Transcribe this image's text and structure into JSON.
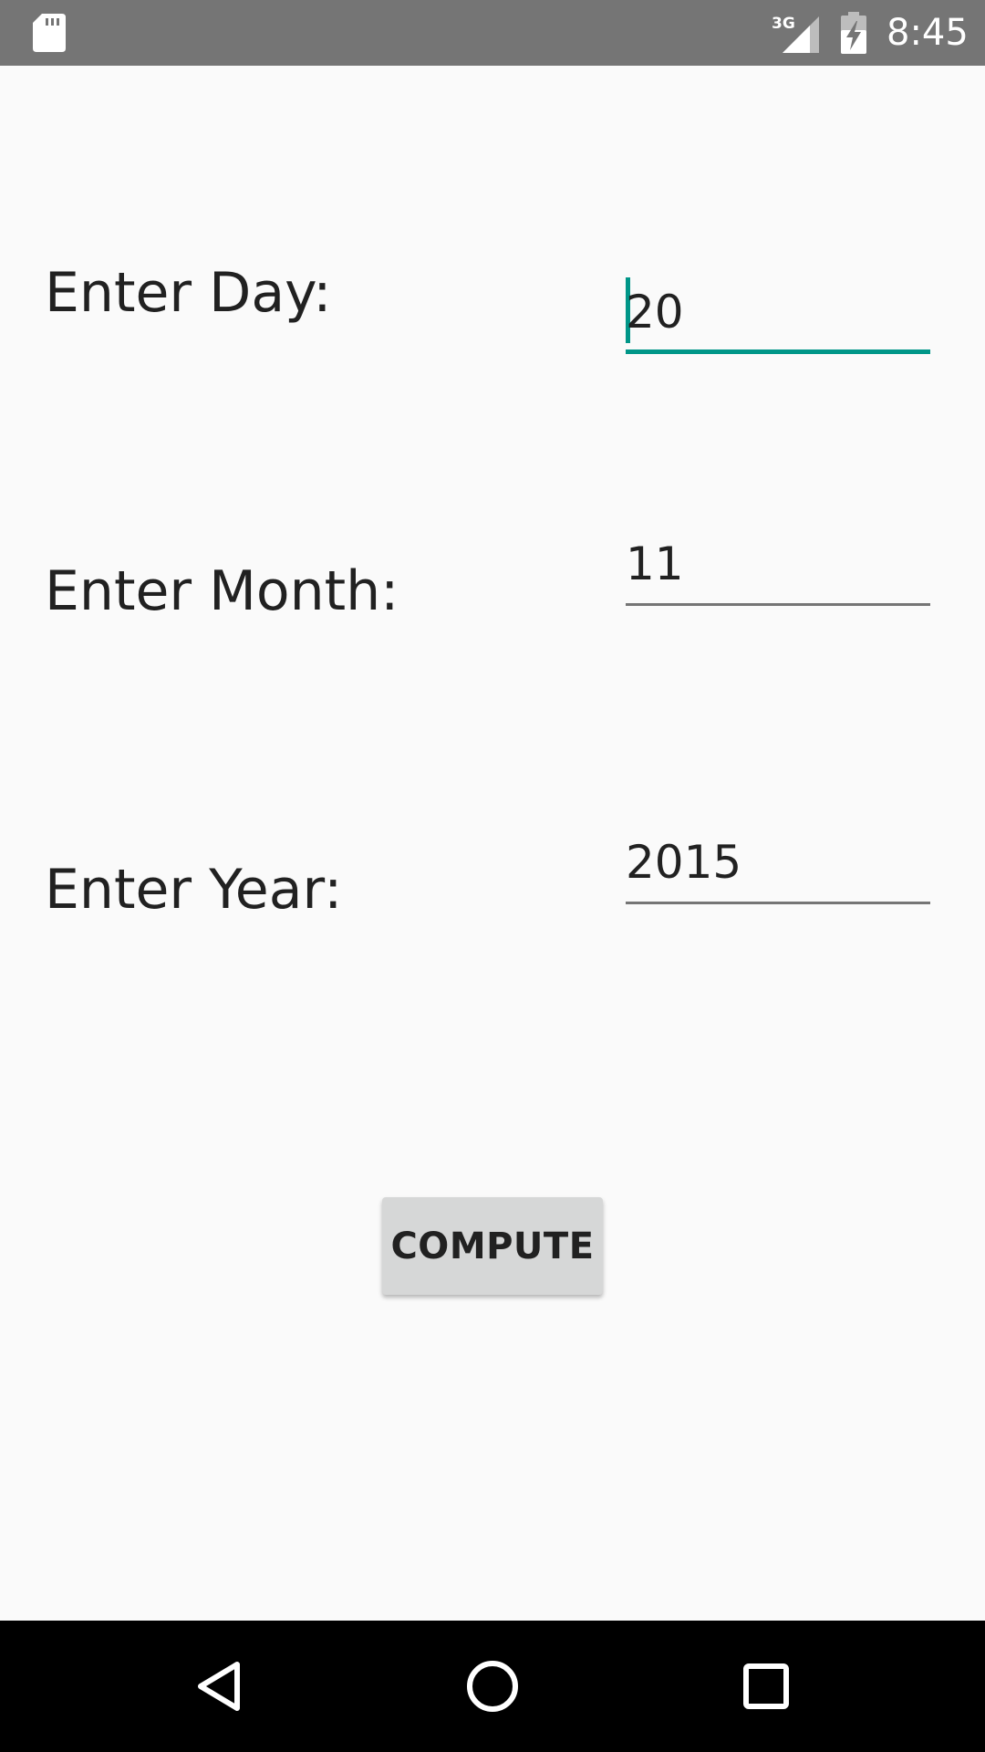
{
  "status_bar": {
    "time": "8:45",
    "network_label": "3G",
    "icons": [
      "sd-card-icon",
      "signal-3g-icon",
      "battery-charging-icon"
    ]
  },
  "form": {
    "day": {
      "label": "Enter Day:",
      "value": "20"
    },
    "month": {
      "label": "Enter Month:",
      "value": "11"
    },
    "year": {
      "label": "Enter Year:",
      "value": "2015"
    }
  },
  "actions": {
    "compute_label": "COMPUTE"
  },
  "nav_bar": {
    "icons": [
      "back-icon",
      "home-icon",
      "recents-icon"
    ]
  },
  "colors": {
    "accent": "#009688",
    "status_bar": "#757575",
    "background": "#fafafa",
    "button": "#d6d7d7"
  }
}
